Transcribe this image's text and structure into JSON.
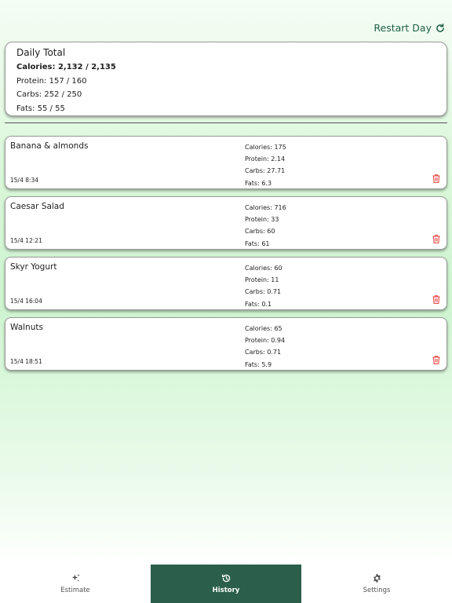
{
  "header": {
    "restart_label": "Restart Day"
  },
  "daily_total": {
    "title": "Daily Total",
    "calories": "Calories: 2,132 / 2,135",
    "protein": "Protein: 157 / 160",
    "carbs": "Carbs: 252 / 250",
    "fats": "Fats: 55 / 55"
  },
  "entries": [
    {
      "name": "Banana & almonds",
      "time": "15/4 8:34",
      "calories": "Calories: 175",
      "protein": "Protein: 2.14",
      "carbs": "Carbs: 27.71",
      "fats": "Fats: 6.3"
    },
    {
      "name": "Caesar Salad",
      "time": "15/4 12:21",
      "calories": "Calories: 716",
      "protein": "Protein: 33",
      "carbs": "Carbs: 60",
      "fats": "Fats: 61"
    },
    {
      "name": "Skyr Yogurt",
      "time": "15/4 16:04",
      "calories": "Calories: 60",
      "protein": "Protein: 11",
      "carbs": "Carbs: 0.71",
      "fats": "Fats: 0.1"
    },
    {
      "name": "Walnuts",
      "time": "15/4 18:51",
      "calories": "Calories: 65",
      "protein": "Protein: 0.94",
      "carbs": "Carbs: 0.71",
      "fats": "Fats: 5.9"
    }
  ],
  "nav": {
    "active": "History",
    "items": [
      {
        "label": "Estimate",
        "icon": "sparkle-icon"
      },
      {
        "label": "History",
        "icon": "history-icon"
      },
      {
        "label": "Settings",
        "icon": "gear-icon"
      }
    ]
  },
  "colors": {
    "accent": "#2b5f4c",
    "delete": "#e53935",
    "restart": "#1f5f47"
  }
}
